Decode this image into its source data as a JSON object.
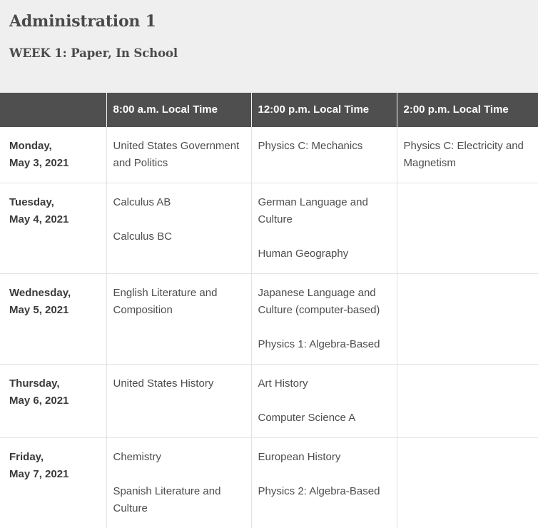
{
  "header": {
    "title": "Administration 1",
    "subtitle": "WEEK 1: Paper, In School"
  },
  "colors": {
    "page_background": "#efefef",
    "table_header_background": "#4f4f4f",
    "table_header_text": "#ffffff",
    "body_text": "#4d4d4d",
    "date_text": "#3b3b3b",
    "grid_line": "#e2e2e2"
  },
  "table": {
    "columns": [
      {
        "label": ""
      },
      {
        "label": "8:00 a.m. Local Time"
      },
      {
        "label": "12:00 p.m. Local Time"
      },
      {
        "label": "2:00 p.m. Local Time"
      }
    ],
    "rows": [
      {
        "day": "Monday,",
        "date": "May 3, 2021",
        "slot_8am": [
          "United States Government and Politics"
        ],
        "slot_12pm": [
          "Physics C: Mechanics"
        ],
        "slot_2pm": [
          "Physics C: Electricity and Magnetism"
        ]
      },
      {
        "day": "Tuesday,",
        "date": "May 4, 2021",
        "slot_8am": [
          "Calculus AB",
          "Calculus BC"
        ],
        "slot_12pm": [
          "German Language and Culture",
          "Human Geography"
        ],
        "slot_2pm": []
      },
      {
        "day": "Wednesday,",
        "date": "May 5, 2021",
        "slot_8am": [
          "English Literature and Composition"
        ],
        "slot_12pm": [
          "Japanese Language and Culture (computer-based)",
          "Physics 1: Algebra-Based"
        ],
        "slot_2pm": []
      },
      {
        "day": "Thursday,",
        "date": "May 6, 2021",
        "slot_8am": [
          "United States History"
        ],
        "slot_12pm": [
          "Art History",
          "Computer Science A"
        ],
        "slot_2pm": []
      },
      {
        "day": "Friday,",
        "date": "May 7, 2021",
        "slot_8am": [
          "Chemistry",
          "Spanish Literature and Culture"
        ],
        "slot_12pm": [
          "European History",
          "Physics 2: Algebra-Based"
        ],
        "slot_2pm": []
      }
    ]
  }
}
